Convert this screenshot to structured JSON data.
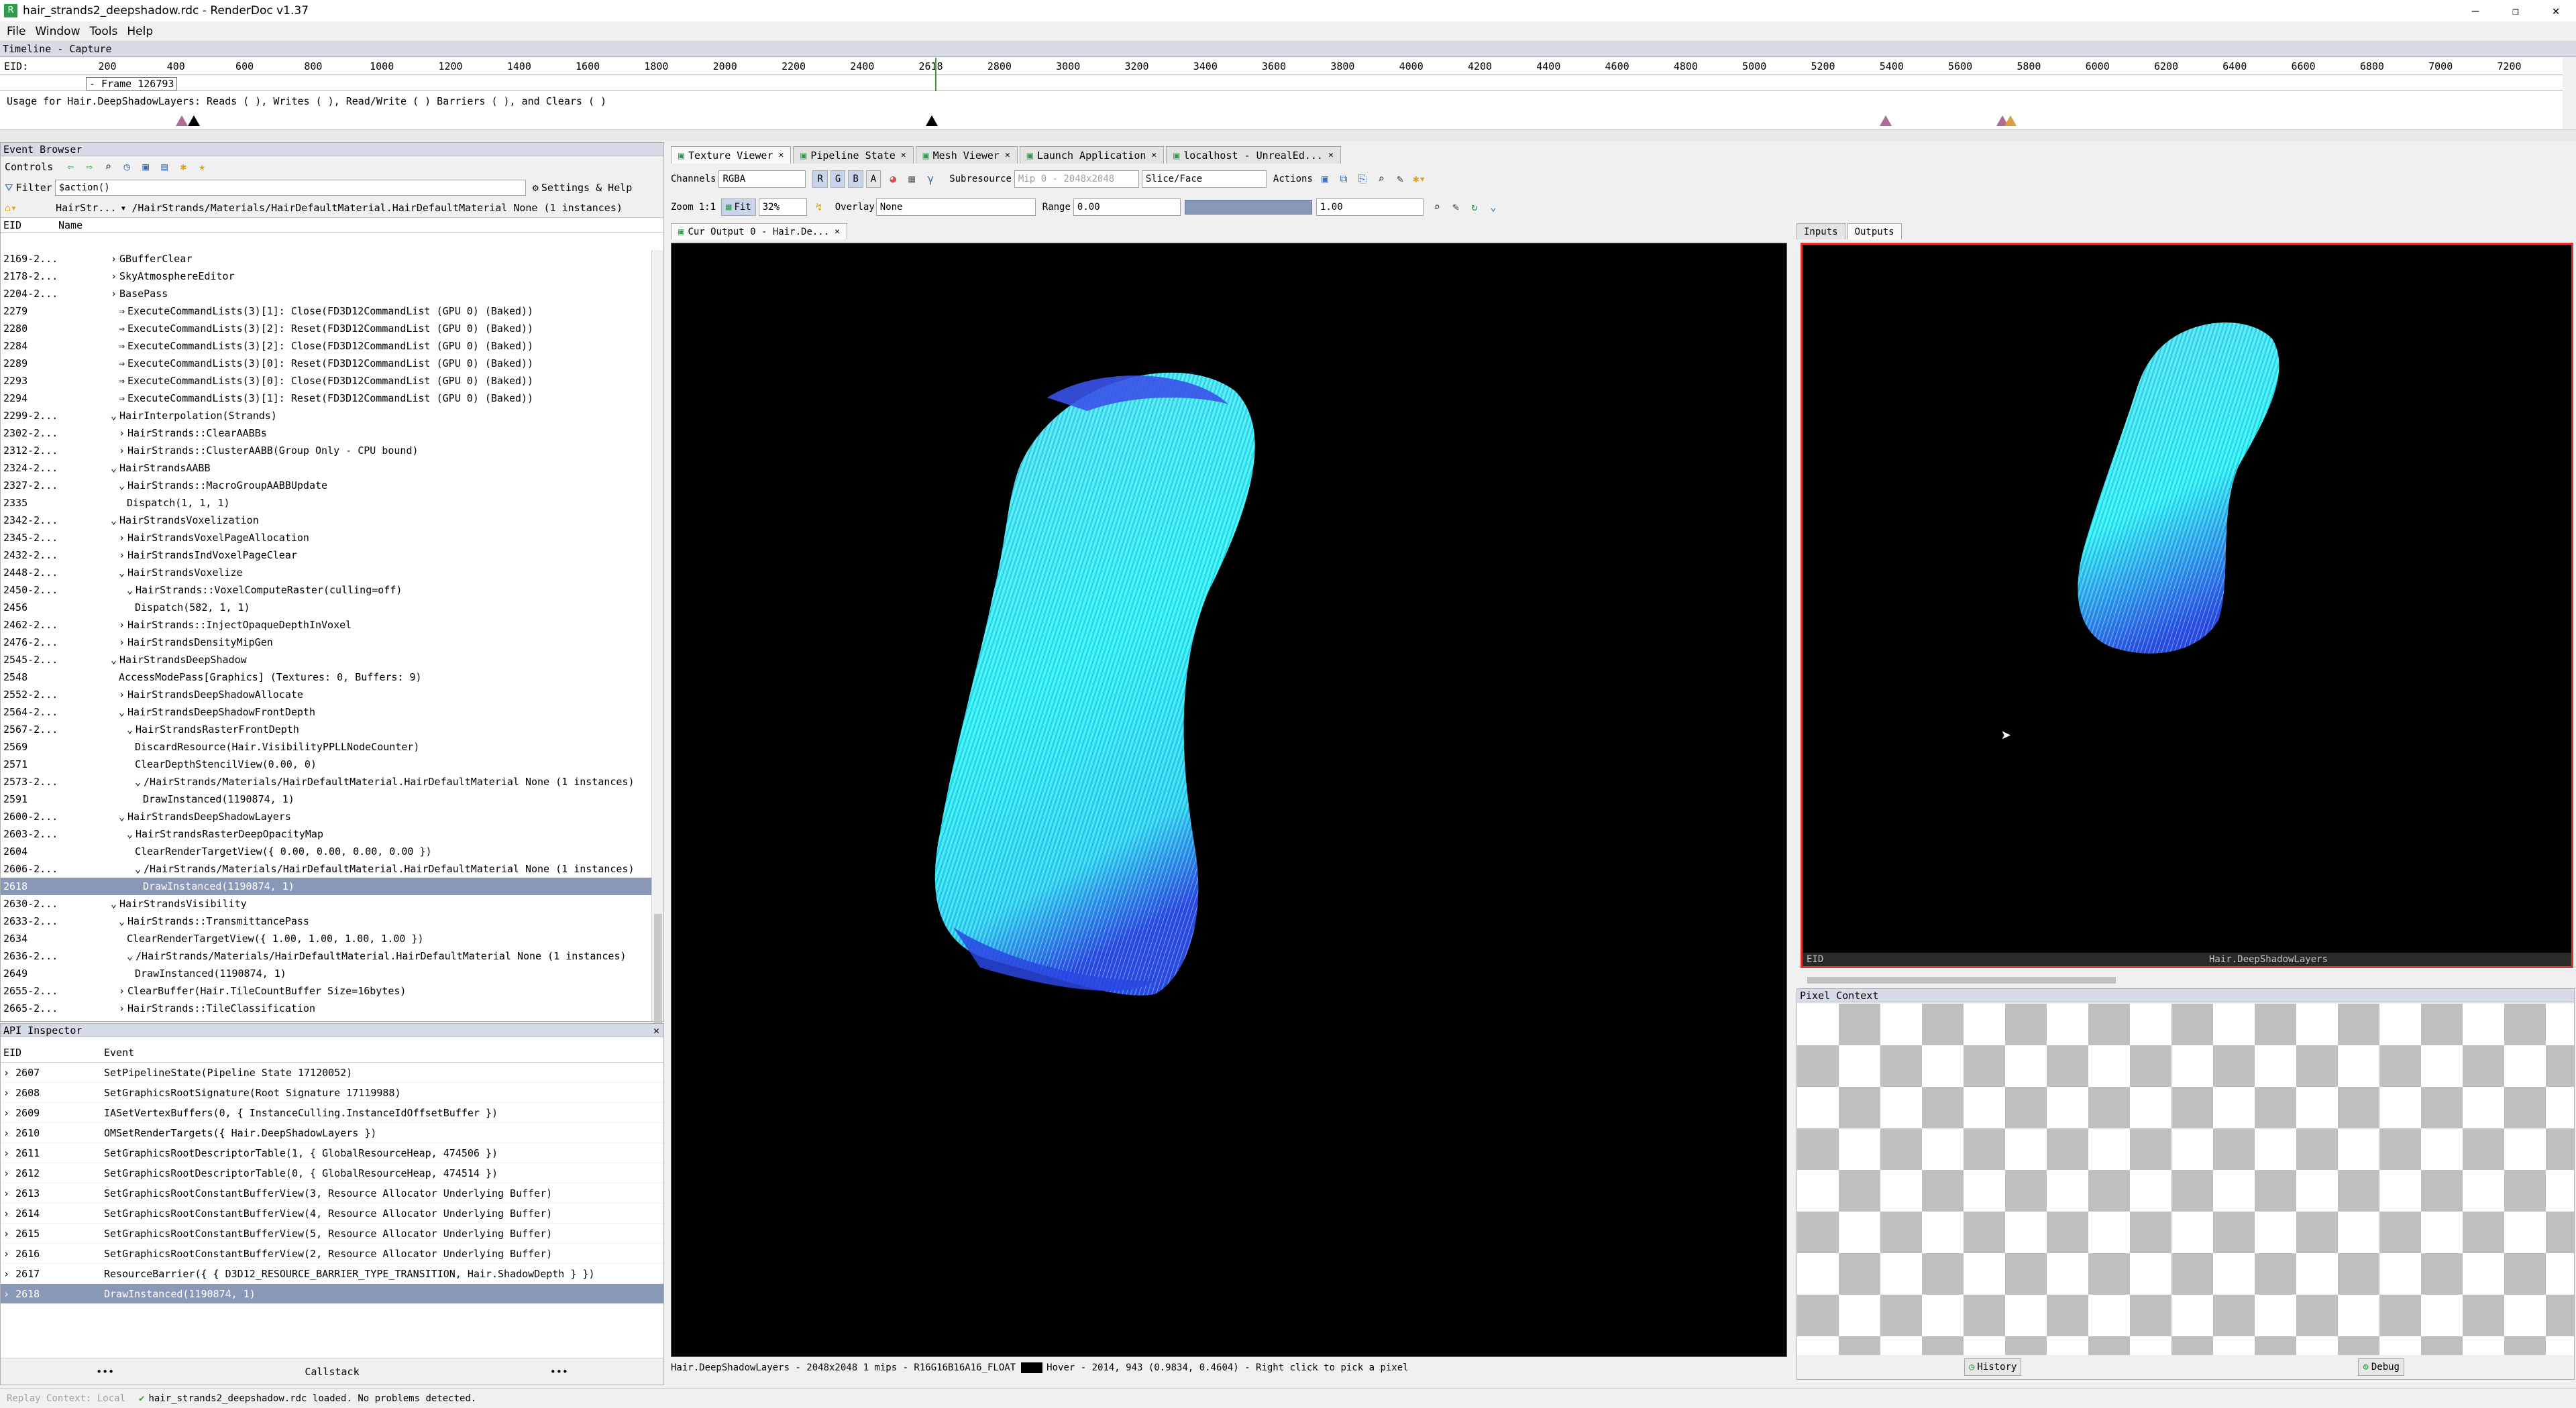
{
  "window": {
    "title": "hair_strands2_deepshadow.rdc - RenderDoc v1.37",
    "app_icon": "renderdoc-icon"
  },
  "menu": [
    "File",
    "Window",
    "Tools",
    "Help"
  ],
  "timeline": {
    "header": "Timeline - Capture",
    "eid_label": "EID:",
    "frame_label": "- Frame 126793",
    "ticks": [
      "200",
      "400",
      "600",
      "800",
      "1000",
      "1200",
      "1400",
      "1600",
      "1800",
      "2000",
      "2200",
      "2400",
      "2618",
      "2800",
      "3000",
      "3200",
      "3400",
      "3600",
      "3800",
      "4000",
      "4200",
      "4400",
      "4600",
      "4800",
      "5000",
      "5200",
      "5400",
      "5600",
      "5800",
      "6000",
      "6200",
      "6400",
      "6600",
      "6800",
      "7000",
      "7200"
    ],
    "usage_text": "Usage for Hair.DeepShadowLayers: Reads ( ), Writes ( ), Read/Write ( ) Barriers ( ), and Clears ( )"
  },
  "event_browser": {
    "title": "Event Browser",
    "controls_label": "Controls",
    "filter_label": "Filter",
    "filter_value": "$action()",
    "settings_label": "Settings & Help",
    "breadcrumb_prefix": "HairStr...",
    "breadcrumb": "/HairStrands/Materials/HairDefaultMaterial.HairDefaultMaterial None (1 instances)",
    "col_eid": "EID",
    "col_name": "Name",
    "rows": [
      {
        "eid": "2169-2...",
        "name": "GBufferClear",
        "indent": 0,
        "ex": "›"
      },
      {
        "eid": "2178-2...",
        "name": "SkyAtmosphereEditor",
        "indent": 0,
        "ex": "›"
      },
      {
        "eid": "2204-2...",
        "name": "BasePass",
        "indent": 0,
        "ex": "›"
      },
      {
        "eid": "2279",
        "name": "ExecuteCommandLists(3)[1]: Close(FD3D12CommandList (GPU 0) (Baked))",
        "indent": 1,
        "ex": "⇒"
      },
      {
        "eid": "2280",
        "name": "ExecuteCommandLists(3)[2]: Reset(FD3D12CommandList (GPU 0) (Baked))",
        "indent": 1,
        "ex": "⇒"
      },
      {
        "eid": "2284",
        "name": "ExecuteCommandLists(3)[2]: Close(FD3D12CommandList (GPU 0) (Baked))",
        "indent": 1,
        "ex": "⇒"
      },
      {
        "eid": "2289",
        "name": "ExecuteCommandLists(3)[0]: Reset(FD3D12CommandList (GPU 0) (Baked))",
        "indent": 1,
        "ex": "⇒"
      },
      {
        "eid": "2293",
        "name": "ExecuteCommandLists(3)[0]: Close(FD3D12CommandList (GPU 0) (Baked))",
        "indent": 1,
        "ex": "⇒"
      },
      {
        "eid": "2294",
        "name": "ExecuteCommandLists(3)[1]: Reset(FD3D12CommandList (GPU 0) (Baked))",
        "indent": 1,
        "ex": "⇒"
      },
      {
        "eid": "2299-2...",
        "name": "HairInterpolation(Strands)",
        "indent": 0,
        "ex": "⌄"
      },
      {
        "eid": "2302-2...",
        "name": "HairStrands::ClearAABBs",
        "indent": 1,
        "ex": "›"
      },
      {
        "eid": "2312-2...",
        "name": "HairStrands::ClusterAABB(Group Only - CPU bound)",
        "indent": 1,
        "ex": "›"
      },
      {
        "eid": "2324-2...",
        "name": "HairStrandsAABB",
        "indent": 0,
        "ex": "⌄"
      },
      {
        "eid": "2327-2...",
        "name": "HairStrands::MacroGroupAABBUpdate",
        "indent": 1,
        "ex": "⌄"
      },
      {
        "eid": "2335",
        "name": "Dispatch(1, 1, 1)",
        "indent": 2,
        "ex": ""
      },
      {
        "eid": "2342-2...",
        "name": "HairStrandsVoxelization",
        "indent": 0,
        "ex": "⌄"
      },
      {
        "eid": "2345-2...",
        "name": "HairStrandsVoxelPageAllocation",
        "indent": 1,
        "ex": "›"
      },
      {
        "eid": "2432-2...",
        "name": "HairStrandsIndVoxelPageClear",
        "indent": 1,
        "ex": "›"
      },
      {
        "eid": "2448-2...",
        "name": "HairStrandsVoxelize",
        "indent": 1,
        "ex": "⌄"
      },
      {
        "eid": "2450-2...",
        "name": "HairStrands::VoxelComputeRaster(culling=off)",
        "indent": 2,
        "ex": "⌄"
      },
      {
        "eid": "2456",
        "name": "Dispatch(582, 1, 1)",
        "indent": 3,
        "ex": ""
      },
      {
        "eid": "2462-2...",
        "name": "HairStrands::InjectOpaqueDepthInVoxel",
        "indent": 1,
        "ex": "›"
      },
      {
        "eid": "2476-2...",
        "name": "HairStrandsDensityMipGen",
        "indent": 1,
        "ex": "›"
      },
      {
        "eid": "2545-2...",
        "name": "HairStrandsDeepShadow",
        "indent": 0,
        "ex": "⌄"
      },
      {
        "eid": "2548",
        "name": "AccessModePass[Graphics] (Textures: 0, Buffers: 9)",
        "indent": 1,
        "ex": ""
      },
      {
        "eid": "2552-2...",
        "name": "HairStrandsDeepShadowAllocate",
        "indent": 1,
        "ex": "›"
      },
      {
        "eid": "2564-2...",
        "name": "HairStrandsDeepShadowFrontDepth",
        "indent": 1,
        "ex": "⌄"
      },
      {
        "eid": "2567-2...",
        "name": "HairStrandsRasterFrontDepth",
        "indent": 2,
        "ex": "⌄"
      },
      {
        "eid": "2569",
        "name": "DiscardResource(Hair.VisibilityPPLLNodeCounter)",
        "indent": 3,
        "ex": ""
      },
      {
        "eid": "2571",
        "name": "ClearDepthStencilView(0.00, 0)",
        "indent": 3,
        "ex": ""
      },
      {
        "eid": "2573-2...",
        "name": "/HairStrands/Materials/HairDefaultMaterial.HairDefaultMaterial None (1 instances)",
        "indent": 3,
        "ex": "⌄"
      },
      {
        "eid": "2591",
        "name": "DrawInstanced(1190874, 1)",
        "indent": 4,
        "ex": ""
      },
      {
        "eid": "2600-2...",
        "name": "HairStrandsDeepShadowLayers",
        "indent": 1,
        "ex": "⌄"
      },
      {
        "eid": "2603-2...",
        "name": "HairStrandsRasterDeepOpacityMap",
        "indent": 2,
        "ex": "⌄"
      },
      {
        "eid": "2604",
        "name": "ClearRenderTargetView({ 0.00, 0.00, 0.00, 0.00 })",
        "indent": 3,
        "ex": ""
      },
      {
        "eid": "2606-2...",
        "name": "/HairStrands/Materials/HairDefaultMaterial.HairDefaultMaterial None (1 instances)",
        "indent": 3,
        "ex": "⌄"
      },
      {
        "eid": "2618",
        "name": "DrawInstanced(1190874, 1)",
        "indent": 4,
        "ex": "",
        "sel": true
      },
      {
        "eid": "2630-2...",
        "name": "HairStrandsVisibility",
        "indent": 0,
        "ex": "⌄"
      },
      {
        "eid": "2633-2...",
        "name": "HairStrands::TransmittancePass",
        "indent": 1,
        "ex": "⌄"
      },
      {
        "eid": "2634",
        "name": "ClearRenderTargetView({ 1.00, 1.00, 1.00, 1.00 })",
        "indent": 2,
        "ex": ""
      },
      {
        "eid": "2636-2...",
        "name": "/HairStrands/Materials/HairDefaultMaterial.HairDefaultMaterial None (1 instances)",
        "indent": 2,
        "ex": "⌄"
      },
      {
        "eid": "2649",
        "name": "DrawInstanced(1190874, 1)",
        "indent": 3,
        "ex": ""
      },
      {
        "eid": "2655-2...",
        "name": "ClearBuffer(Hair.TileCountBuffer Size=16bytes)",
        "indent": 1,
        "ex": "›"
      },
      {
        "eid": "2665-2...",
        "name": "HairStrands::TileClassification",
        "indent": 1,
        "ex": "›"
      }
    ]
  },
  "api_inspector": {
    "title": "API Inspector",
    "col_eid": "EID",
    "col_event": "Event",
    "rows": [
      {
        "eid": "2607",
        "text": "SetPipelineState(Pipeline State 17120052)"
      },
      {
        "eid": "2608",
        "text": "SetGraphicsRootSignature(Root Signature 17119988)"
      },
      {
        "eid": "2609",
        "text": "IASetVertexBuffers(0, { InstanceCulling.InstanceIdOffsetBuffer })"
      },
      {
        "eid": "2610",
        "text": "OMSetRenderTargets({ Hair.DeepShadowLayers })"
      },
      {
        "eid": "2611",
        "text": "SetGraphicsRootDescriptorTable(1, { GlobalResourceHeap, 474506 })"
      },
      {
        "eid": "2612",
        "text": "SetGraphicsRootDescriptorTable(0, { GlobalResourceHeap, 474514 })"
      },
      {
        "eid": "2613",
        "text": "SetGraphicsRootConstantBufferView(3, Resource Allocator Underlying Buffer)"
      },
      {
        "eid": "2614",
        "text": "SetGraphicsRootConstantBufferView(4, Resource Allocator Underlying Buffer)"
      },
      {
        "eid": "2615",
        "text": "SetGraphicsRootConstantBufferView(5, Resource Allocator Underlying Buffer)"
      },
      {
        "eid": "2616",
        "text": "SetGraphicsRootConstantBufferView(2, Resource Allocator Underlying Buffer)"
      },
      {
        "eid": "2617",
        "text": "ResourceBarrier({ { D3D12_RESOURCE_BARRIER_TYPE_TRANSITION, Hair.ShadowDepth } })"
      },
      {
        "eid": "2618",
        "text": "DrawInstanced(1190874, 1)",
        "sel": true
      }
    ],
    "callstack_label": "Callstack"
  },
  "tabs": [
    {
      "label": "Texture Viewer",
      "active": true
    },
    {
      "label": "Pipeline State"
    },
    {
      "label": "Mesh Viewer"
    },
    {
      "label": "Launch Application"
    },
    {
      "label": "localhost - UnrealEd..."
    }
  ],
  "texture_toolbar": {
    "channels_label": "Channels",
    "channels_value": "RGBA",
    "r": "R",
    "g": "G",
    "b": "B",
    "a": "A",
    "subresource_label": "Subresource",
    "mip_value": "Mip 0 - 2048x2048",
    "slice_value": "Slice/Face",
    "actions_label": "Actions",
    "zoom_label": "Zoom",
    "zoom_11": "1:1",
    "fit_label": "Fit",
    "zoom_value": "32%",
    "overlay_label": "Overlay",
    "overlay_value": "None",
    "range_label": "Range",
    "range_min": "0.00",
    "range_max": "1.00"
  },
  "output_tab": "Cur Output 0 - Hair.De...",
  "status_text": "Hair.DeepShadowLayers - 2048x2048 1 mips - R16G16B16A16_FLOAT",
  "hover_text": "Hover - 2014, 943 (0.9834, 0.4604) - Right click to pick a pixel",
  "right_panel": {
    "tabs": [
      "Inputs",
      "Outputs"
    ],
    "thumb_eid": "EID",
    "thumb_label": "Hair.DeepShadowLayers",
    "pixel_context": "Pixel Context",
    "history_btn": "History",
    "debug_btn": "Debug"
  },
  "footer": {
    "replay": "Replay Context: Local",
    "status": "hair_strands2_deepshadow.rdc loaded. No problems detected."
  },
  "colors": {
    "accent": "#3a6fb0",
    "selection": "#8a98b8",
    "hair_cyan": "#2ff4f4",
    "hair_blue": "#2a4ae0",
    "border_red": "#e03030"
  }
}
